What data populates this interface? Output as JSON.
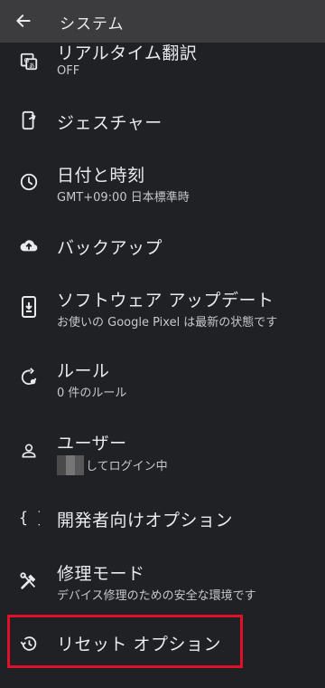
{
  "appbar": {
    "title": "システム",
    "back_icon": "arrow-back-icon"
  },
  "items": [
    {
      "title": "リアルタイム翻訳",
      "subtitle": "OFF",
      "icon": "translate-icon"
    },
    {
      "title": "ジェスチャー",
      "subtitle": "",
      "icon": "gesture-phone-icon"
    },
    {
      "title": "日付と時刻",
      "subtitle": "GMT+09:00 日本標準時",
      "icon": "clock-icon"
    },
    {
      "title": "バックアップ",
      "subtitle": "",
      "icon": "cloud-upload-icon"
    },
    {
      "title": "ソフトウェア アップデート",
      "subtitle": "お使いの Google Pixel は最新の状態です",
      "icon": "system-update-icon"
    },
    {
      "title": "ルール",
      "subtitle": "0 件のルール",
      "icon": "rules-icon"
    },
    {
      "title": "ユーザー",
      "subtitle": "してログイン中",
      "icon": "person-icon"
    },
    {
      "title": "開発者向けオプション",
      "subtitle": "",
      "icon": "braces-icon"
    },
    {
      "title": "修理モード",
      "subtitle": "デバイス修理のための安全な環境です",
      "icon": "repair-icon"
    },
    {
      "title": "リセット オプション",
      "subtitle": "",
      "icon": "reset-history-icon"
    }
  ],
  "highlight": {
    "target": "リセット オプション",
    "color": "#e0102a"
  }
}
